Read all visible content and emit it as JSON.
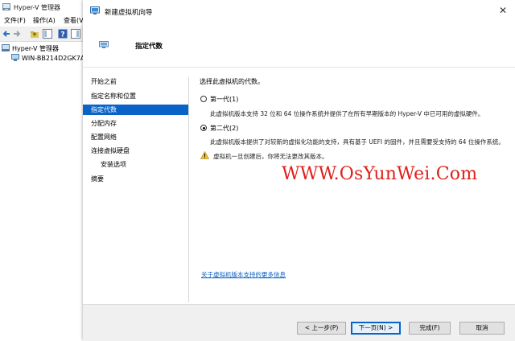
{
  "background_window": {
    "title": "Hyper-V 管理器",
    "menu": [
      "文件(F)",
      "操作(A)",
      "查看(V"
    ],
    "tree": {
      "root": "Hyper-V 管理器",
      "child": "WIN-BB214D2GK7A"
    }
  },
  "wizard": {
    "title": "新建虚拟机向导",
    "close_glyph": "✕",
    "header_title": "指定代数",
    "steps": [
      {
        "label": "开始之前",
        "sub": false,
        "active": false
      },
      {
        "label": "指定名称和位置",
        "sub": false,
        "active": false
      },
      {
        "label": "指定代数",
        "sub": false,
        "active": true
      },
      {
        "label": "分配内存",
        "sub": false,
        "active": false
      },
      {
        "label": "配置网络",
        "sub": false,
        "active": false
      },
      {
        "label": "连接虚拟硬盘",
        "sub": false,
        "active": false
      },
      {
        "label": "安装选项",
        "sub": true,
        "active": false
      },
      {
        "label": "摘要",
        "sub": false,
        "active": false
      }
    ],
    "prompt": "选择此虚拟机的代数。",
    "options": [
      {
        "label": "第一代(1)",
        "selected": false,
        "description": "此虚拟机版本支持 32 位和 64 位操作系统并提供了在所有早期版本的 Hyper-V 中已可用的虚拟硬件。"
      },
      {
        "label": "第二代(2)",
        "selected": true,
        "description": "此虚拟机版本提供了对较新的虚拟化功能的支持，具有基于 UEFI 的固件，并且需要受支持的 64 位操作系统。"
      }
    ],
    "warning": "虚拟机一旦创建后，你将无法更改其版本。",
    "more_info_link": "关于虚拟机版本支持的更多信息",
    "watermark": "WWW.OsYunWei.Com",
    "buttons": {
      "prev": "< 上一步(P)",
      "next": "下一页(N) >",
      "finish": "完成(F)",
      "cancel": "取消"
    }
  },
  "colors": {
    "selection": "#0a64c8",
    "link": "#0a5fbf",
    "watermark": "#e0201a"
  }
}
